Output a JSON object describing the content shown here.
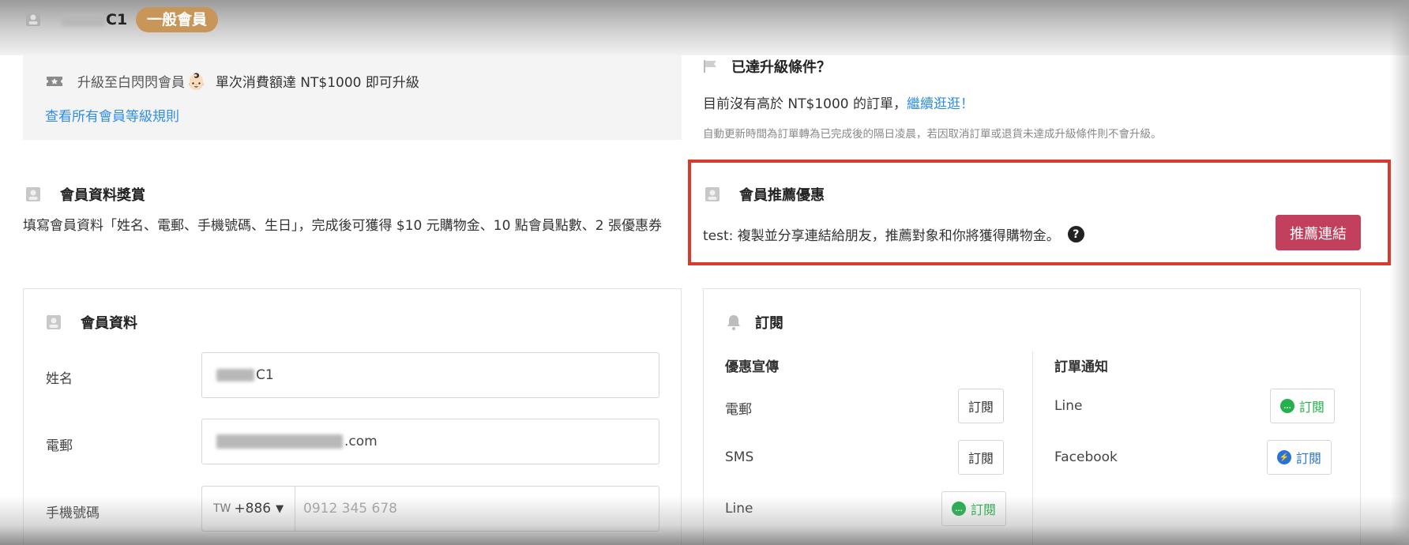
{
  "header": {
    "member_name": "C1",
    "badge": "一般會員"
  },
  "upgrade": {
    "prefix": "升級至白閃閃會員",
    "emoji": "👶🏻",
    "condition": "單次消費額達 NT$1000 即可升級",
    "rules_link": "查看所有會員等級規則"
  },
  "reach": {
    "title": "已達升級條件？",
    "no_order": "目前沒有高於 NT$1000 的訂單，",
    "continue_link": "繼續逛逛！",
    "note": "自動更新時間為訂單轉為已完成後的隔日凌晨，若因取消訂單或退貨未達成升級條件則不會升級。"
  },
  "profile_reward": {
    "title": "會員資料獎賞",
    "text": "填寫會員資料「姓名、電郵、手機號碼、生日」，完成後可獲得 $10 元購物金、10 點會員點數、2 張優惠券"
  },
  "referral": {
    "title": "會員推薦優惠",
    "text": "test: 複製並分享連結給朋友，推薦對象和你將獲得購物金。",
    "help": "?",
    "button": "推薦連結"
  },
  "member_info": {
    "title": "會員資料",
    "name_label": "姓名",
    "name_value": "C1",
    "email_label": "電郵",
    "email_value": ".com",
    "phone_label": "手機號碼",
    "country_code_prefix": "TW",
    "country_code": "+886",
    "country_arrow": "▼",
    "phone_placeholder": "0912 345 678"
  },
  "subscribe": {
    "title": "訂閱",
    "promo_head": "優惠宣傳",
    "order_head": "訂單通知",
    "promo_items": [
      {
        "label": "電郵",
        "button": "訂閱"
      },
      {
        "label": "SMS",
        "button": "訂閱"
      },
      {
        "label": "Line",
        "button": "訂閱"
      }
    ],
    "order_items": [
      {
        "label": "Line",
        "button": "訂閱"
      },
      {
        "label": "Facebook",
        "button": "訂閱"
      }
    ]
  },
  "colors": {
    "badge": "#c9965a",
    "referral_button": "#c2405d",
    "highlight_border": "#d83a2b",
    "link": "#2f8de4",
    "line_green": "#22b14c",
    "facebook_blue": "#2a73d6"
  }
}
